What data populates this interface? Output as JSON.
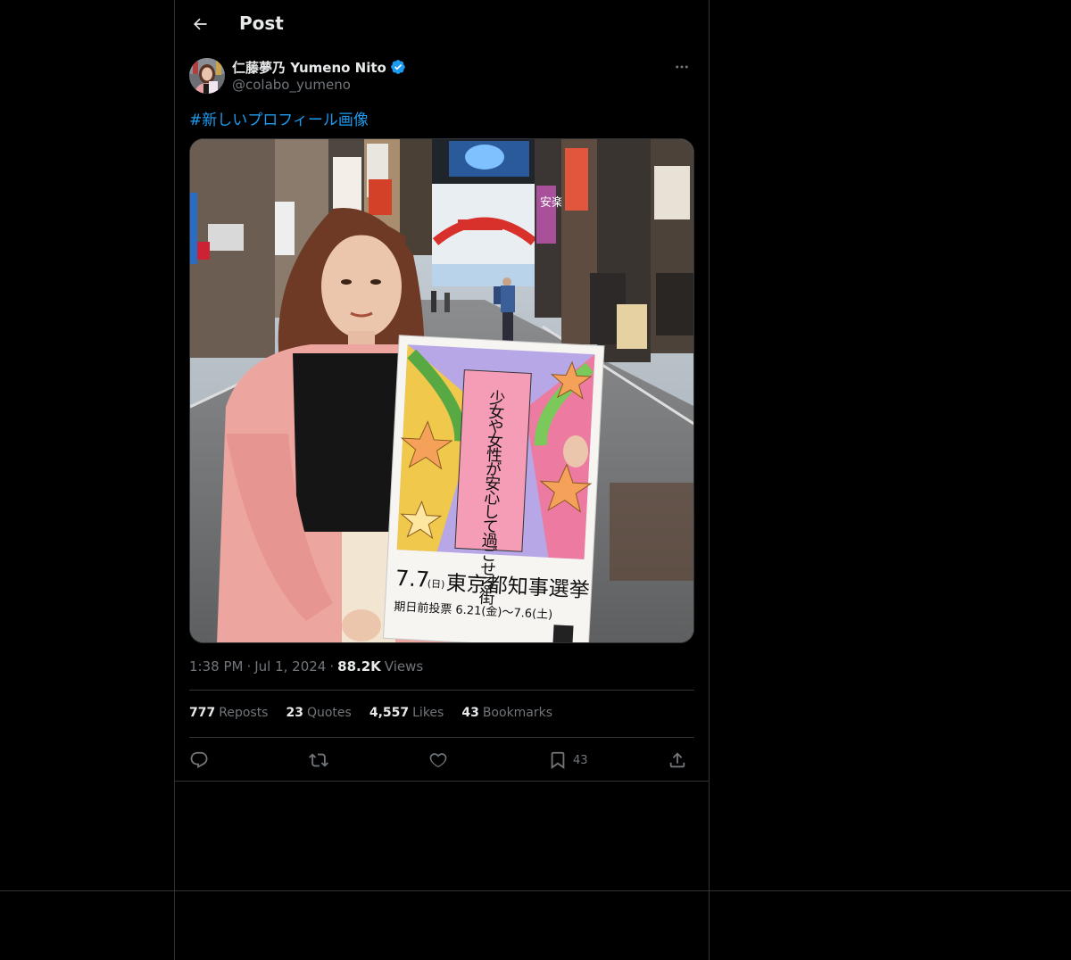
{
  "header": {
    "title": "Post",
    "back_icon": "arrow-left-icon"
  },
  "author": {
    "display_name": "仁藤夢乃 Yumeno Nito",
    "handle": "@colabo_yumeno",
    "verified": true,
    "verified_color": "#1d9bf0"
  },
  "tweet": {
    "text": "#新しいプロフィール画像"
  },
  "media": {
    "sign": {
      "vertical_text": "少女や女性が安心して過ごせる街",
      "date_main": "7.7",
      "date_day": "(日)",
      "election": "東京都知事選挙",
      "early_vote": "期日前投票 6.21(金)〜7.6(土)"
    },
    "street_signs": [
      "安楽亭"
    ]
  },
  "meta": {
    "time": "1:38 PM",
    "date": "Jul 1, 2024",
    "views_count": "88.2K",
    "views_label": "Views",
    "sep": "·"
  },
  "stats": [
    {
      "count": "777",
      "label": "Reposts"
    },
    {
      "count": "23",
      "label": "Quotes"
    },
    {
      "count": "4,557",
      "label": "Likes"
    },
    {
      "count": "43",
      "label": "Bookmarks"
    }
  ],
  "actions": {
    "bookmark_count": "43"
  },
  "colors": {
    "accent": "#1d9bf0",
    "background": "#000000",
    "border": "#2f3336",
    "muted": "#71767b",
    "text": "#e7e9ea"
  }
}
